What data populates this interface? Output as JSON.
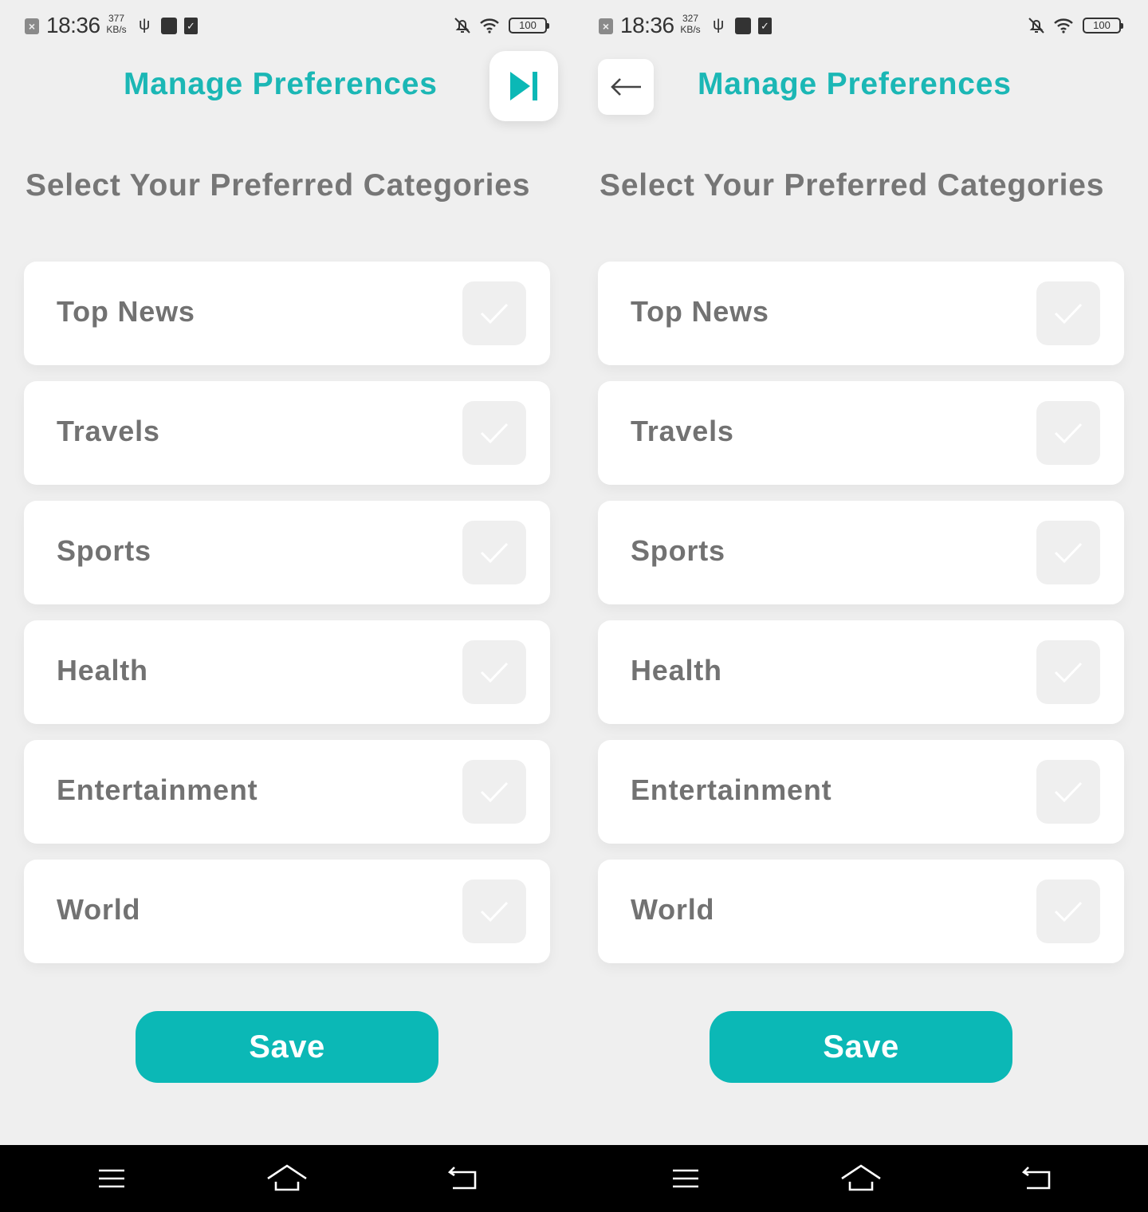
{
  "screens": [
    {
      "status": {
        "time": "18:36",
        "speed_value": "377",
        "speed_unit": "KB/s",
        "battery": "100"
      },
      "header": {
        "title": "Manage Preferences",
        "action_icon": "skip-next-icon"
      },
      "subtitle": "Select Your Preferred Categories",
      "categories": [
        {
          "label": "Top News",
          "checked": false
        },
        {
          "label": "Travels",
          "checked": false
        },
        {
          "label": "Sports",
          "checked": false
        },
        {
          "label": "Health",
          "checked": false
        },
        {
          "label": "Entertainment",
          "checked": false
        },
        {
          "label": "World",
          "checked": false
        }
      ],
      "save_label": "Save"
    },
    {
      "status": {
        "time": "18:36",
        "speed_value": "327",
        "speed_unit": "KB/s",
        "battery": "100"
      },
      "header": {
        "title": "Manage Preferences",
        "action_icon": "back-arrow-icon"
      },
      "subtitle": "Select Your Preferred Categories",
      "categories": [
        {
          "label": "Top News",
          "checked": false
        },
        {
          "label": "Travels",
          "checked": false
        },
        {
          "label": "Sports",
          "checked": false
        },
        {
          "label": "Health",
          "checked": false
        },
        {
          "label": "Entertainment",
          "checked": false
        },
        {
          "label": "World",
          "checked": false
        }
      ],
      "save_label": "Save"
    }
  ],
  "colors": {
    "accent": "#0bb8b6",
    "title": "#1bb7b5",
    "background": "#efefef",
    "card": "#ffffff",
    "label": "#727272"
  },
  "navbar": {
    "icons": [
      "menu-icon",
      "home-icon",
      "back-icon",
      "menu-icon",
      "home-icon",
      "back-icon"
    ]
  }
}
